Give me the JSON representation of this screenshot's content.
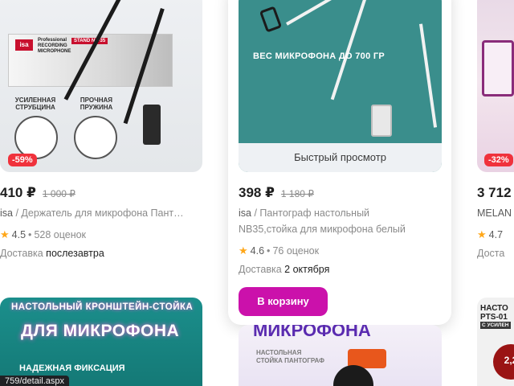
{
  "products": [
    {
      "discount": "-59%",
      "price": "410 ₽",
      "old_price": "1 000 ₽",
      "brand": "isa",
      "title": " / Держатель для микрофона Пант…",
      "rating": "4.5",
      "reviews": "528 оценок",
      "delivery_label": "Доставка",
      "delivery_value": "послезавтра",
      "image_labels": {
        "brand_badge": "isa",
        "rec": "Professional RECORDING MICROPHONE",
        "stand": "STAND NB-35",
        "feature1": "УСИЛЕННАЯ СТРУБЦИНА",
        "feature2": "ПРОЧНАЯ ПРУЖИНА"
      }
    },
    {
      "price": "398 ₽",
      "old_price": "1 180 ₽",
      "brand": "isa",
      "title_line1": " / Пантограф настольный",
      "title_line2": "NB35,стойка для микрофона белый",
      "rating": "4.6",
      "reviews": "76 оценок",
      "delivery_label": "Доставка",
      "delivery_value": "2 октября",
      "quick_view": "Быстрый просмотр",
      "add_to_cart": "В корзину",
      "image_labels": {
        "weight": "ВЕС МИКРОФОНА ДО 700 ГР"
      }
    },
    {
      "discount": "-32%",
      "price": "3 712",
      "brand": "MELAN",
      "rating": "4.7",
      "delivery_label": "Доста"
    }
  ],
  "bottom_row": [
    {
      "line1": "НАСТОЛЬНЫЙ КРОНШТЕЙН-СТОЙКА",
      "line2": "ДЛЯ МИКРОФОНА",
      "line3": "НАДЕЖНАЯ ФИКСАЦИЯ"
    },
    {
      "line1": "МИКРОФОНА",
      "line2": "НАСТОЛЬНАЯ СТОЙКА ПАНТОГРАФ"
    },
    {
      "line1": "НАСТО",
      "line2": "PTS-01",
      "line3": "С УСИЛЕН",
      "badge": "2,2"
    }
  ],
  "status_bar": {
    "url": "759/detail.aspx"
  },
  "colors": {
    "accent": "#cb11ab",
    "discount": "#f0323c",
    "star": "#ffa719"
  }
}
